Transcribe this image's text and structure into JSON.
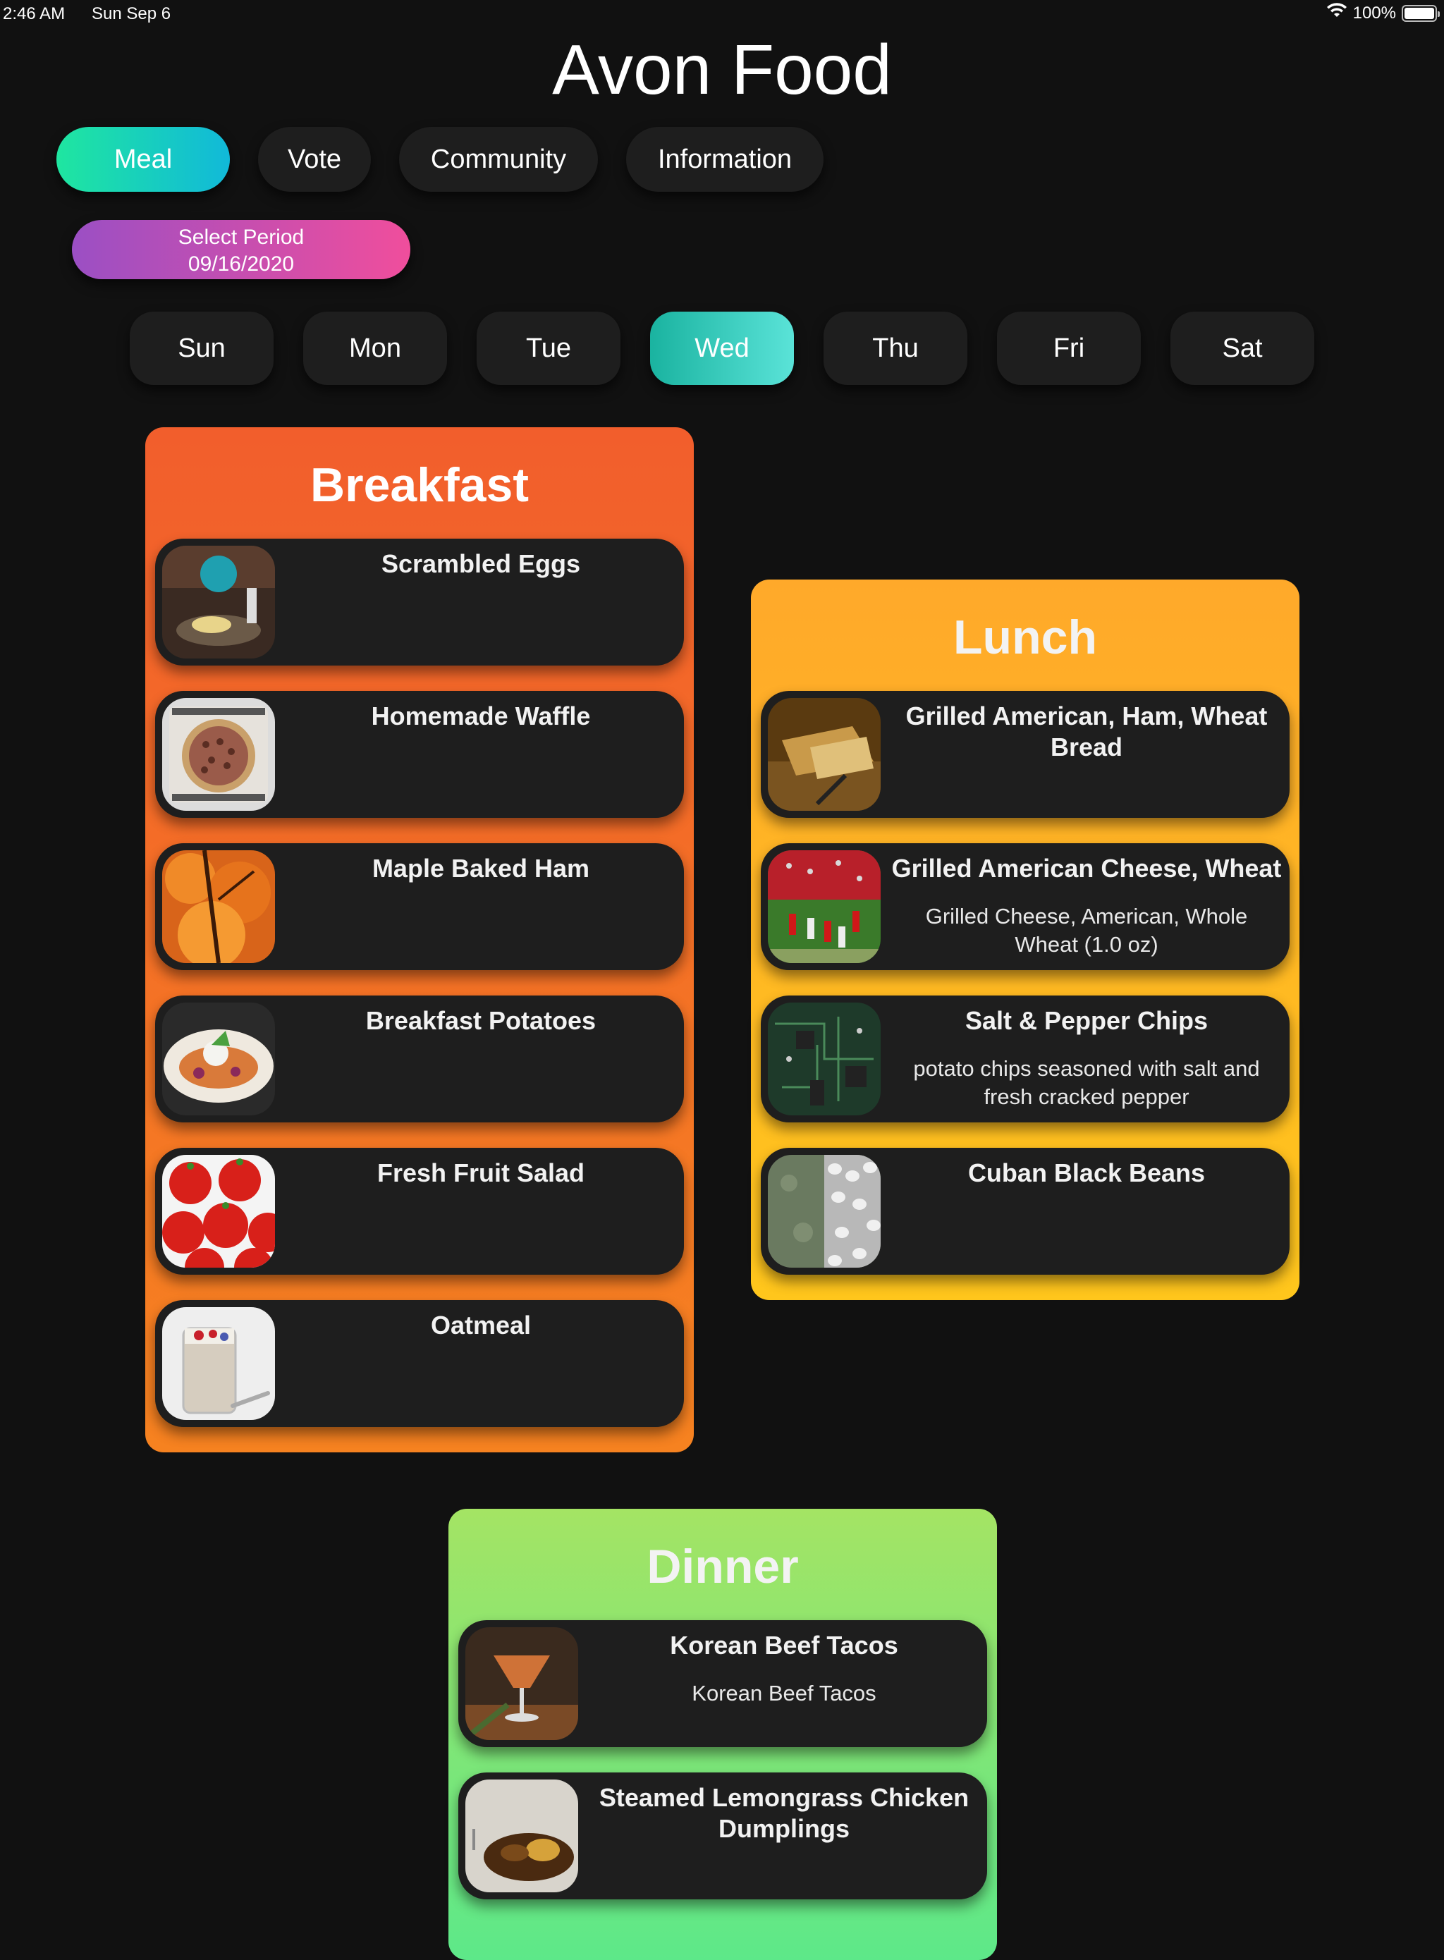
{
  "status": {
    "time": "2:46 AM",
    "date": "Sun Sep 6",
    "battery": "100%",
    "battery_level": 1.0
  },
  "app": {
    "title": "Avon Food"
  },
  "nav": {
    "meal": "Meal",
    "vote": "Vote",
    "community": "Community",
    "information": "Information"
  },
  "period": {
    "label": "Select Period",
    "date": "09/16/2020"
  },
  "days": [
    "Sun",
    "Mon",
    "Tue",
    "Wed",
    "Thu",
    "Fri",
    "Sat"
  ],
  "selected_day": "Wed",
  "breakfast": {
    "title": "Breakfast",
    "items": [
      {
        "name": "Scrambled Eggs",
        "desc": ""
      },
      {
        "name": "Homemade Waffle",
        "desc": ""
      },
      {
        "name": "Maple Baked Ham",
        "desc": ""
      },
      {
        "name": "Breakfast Potatoes",
        "desc": ""
      },
      {
        "name": "Fresh Fruit Salad",
        "desc": ""
      },
      {
        "name": "Oatmeal",
        "desc": ""
      }
    ]
  },
  "lunch": {
    "title": "Lunch",
    "items": [
      {
        "name": "Grilled American, Ham, Wheat Bread",
        "desc": ""
      },
      {
        "name": "Grilled American Cheese, Wheat",
        "desc": "Grilled Cheese, American, Whole Wheat (1.0 oz)"
      },
      {
        "name": "Salt & Pepper Chips",
        "desc": "potato chips seasoned with salt and fresh cracked pepper"
      },
      {
        "name": "Cuban Black Beans",
        "desc": ""
      }
    ]
  },
  "dinner": {
    "title": "Dinner",
    "items": [
      {
        "name": "Korean Beef Tacos",
        "desc": "Korean Beef Tacos"
      },
      {
        "name": "Steamed Lemongrass Chicken Dumplings",
        "desc": ""
      }
    ]
  }
}
